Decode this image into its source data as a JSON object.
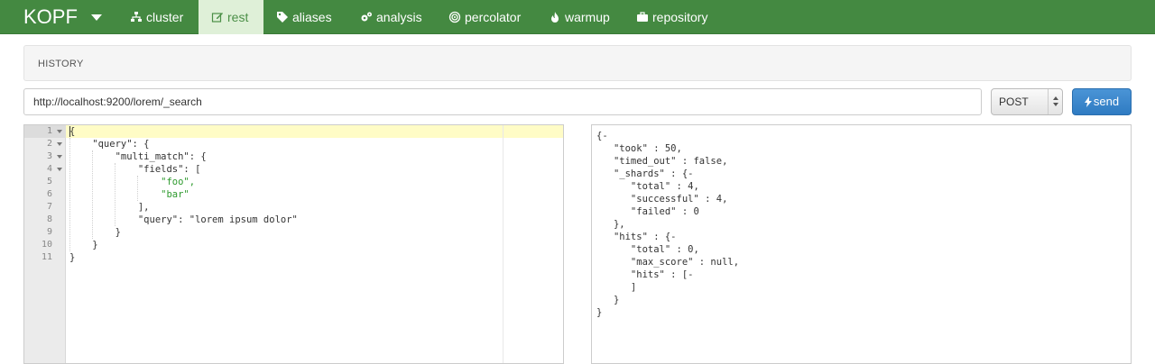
{
  "app": {
    "brand": "KOPF",
    "colors": {
      "navbar": "#448941",
      "active_tab_bg": "#dff0d8",
      "send_button": "#3a87cc",
      "string": "#2e9a2e",
      "number": "#a020a0",
      "boolean": "#1a1aa6"
    }
  },
  "nav": {
    "items": [
      {
        "label": "cluster",
        "icon": "sitemap-icon"
      },
      {
        "label": "rest",
        "icon": "edit-icon",
        "active": true
      },
      {
        "label": "aliases",
        "icon": "tags-icon"
      },
      {
        "label": "analysis",
        "icon": "cogs-icon"
      },
      {
        "label": "percolator",
        "icon": "bullseye-icon"
      },
      {
        "label": "warmup",
        "icon": "fire-icon"
      },
      {
        "label": "repository",
        "icon": "briefcase-icon"
      }
    ]
  },
  "history": {
    "label": "HISTORY"
  },
  "request": {
    "url": "http://localhost:9200/lorem/_search",
    "method": "POST",
    "send_label": "send"
  },
  "editor": {
    "line_numbers": [
      "1",
      "2",
      "3",
      "4",
      "5",
      "6",
      "7",
      "8",
      "9",
      "10",
      "11"
    ],
    "lines": [
      "{",
      "    \"query\": {",
      "        \"multi_match\": {",
      "            \"fields\": [",
      "                \"foo\",",
      "                \"bar\"",
      "            ],",
      "            \"query\": \"lorem ipsum dolor\"",
      "        }",
      "    }",
      "}"
    ]
  },
  "response": {
    "lines": [
      "{-",
      "   \"took\" : 50,",
      "   \"timed_out\" : false,",
      "   \"_shards\" : {-",
      "      \"total\" : 4,",
      "      \"successful\" : 4,",
      "      \"failed\" : 0",
      "   },",
      "   \"hits\" : {-",
      "      \"total\" : 0,",
      "      \"max_score\" : null,",
      "      \"hits\" : [-",
      "      ]",
      "   }",
      "}"
    ]
  }
}
